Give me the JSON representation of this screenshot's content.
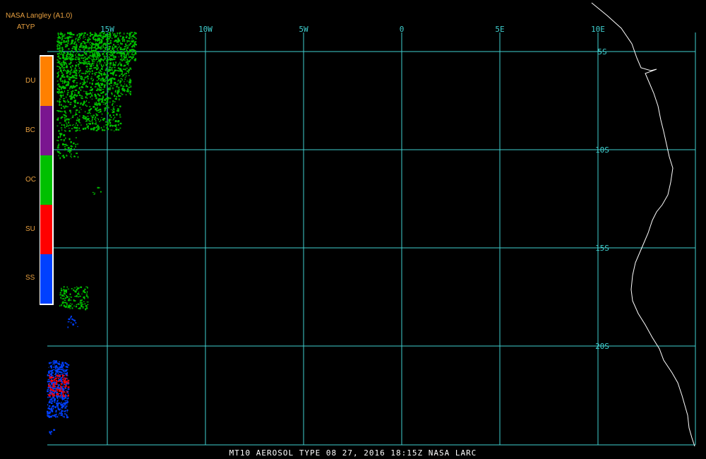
{
  "header": {
    "title": "NASA Langley (A1.0)",
    "product": "ATYP"
  },
  "legend": {
    "items": [
      {
        "code": "DU",
        "color": "#ff8000"
      },
      {
        "code": "BC",
        "color": "#7a1690"
      },
      {
        "code": "OC",
        "color": "#00c000"
      },
      {
        "code": "SU",
        "color": "#ff0000"
      },
      {
        "code": "SS",
        "color": "#0040ff"
      }
    ]
  },
  "grid": {
    "color": "#40d0d0",
    "longitudes": [
      "15W",
      "10W",
      "5W",
      "0",
      "5E",
      "10E"
    ],
    "latitudes": [
      "5S",
      "10S",
      "15S",
      "20S"
    ]
  },
  "footer": {
    "caption": "MT10   AEROSOL TYPE   08 27, 2016 18:15Z   NASA LARC"
  }
}
